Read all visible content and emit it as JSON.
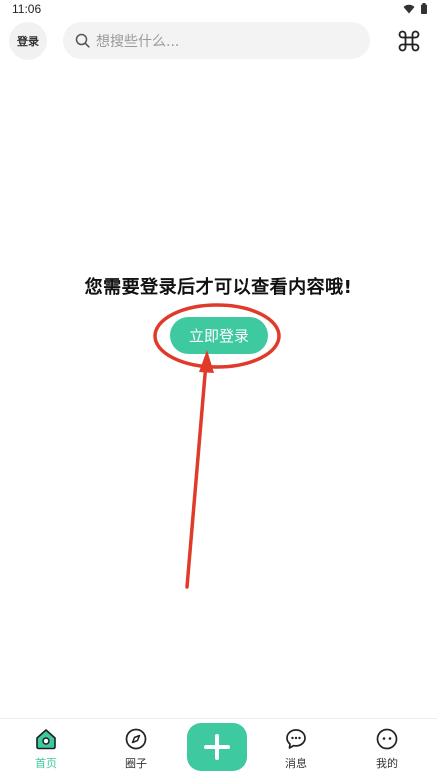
{
  "status_bar": {
    "time": "11:06"
  },
  "header": {
    "login_label": "登录",
    "search_placeholder": "想搜些什么..."
  },
  "main": {
    "message": "您需要登录后才可以查看内容哦!",
    "login_button_label": "立即登录"
  },
  "bottom_nav": {
    "items": [
      {
        "label": "首页",
        "icon": "home-icon",
        "active": true
      },
      {
        "label": "圈子",
        "icon": "compass-icon",
        "active": false
      },
      {
        "label": "",
        "icon": "plus-icon",
        "active": false
      },
      {
        "label": "消息",
        "icon": "message-icon",
        "active": false
      },
      {
        "label": "我的",
        "icon": "profile-icon",
        "active": false
      }
    ]
  },
  "colors": {
    "accent": "#3ec9a0",
    "annotation": "#e03a2b"
  }
}
